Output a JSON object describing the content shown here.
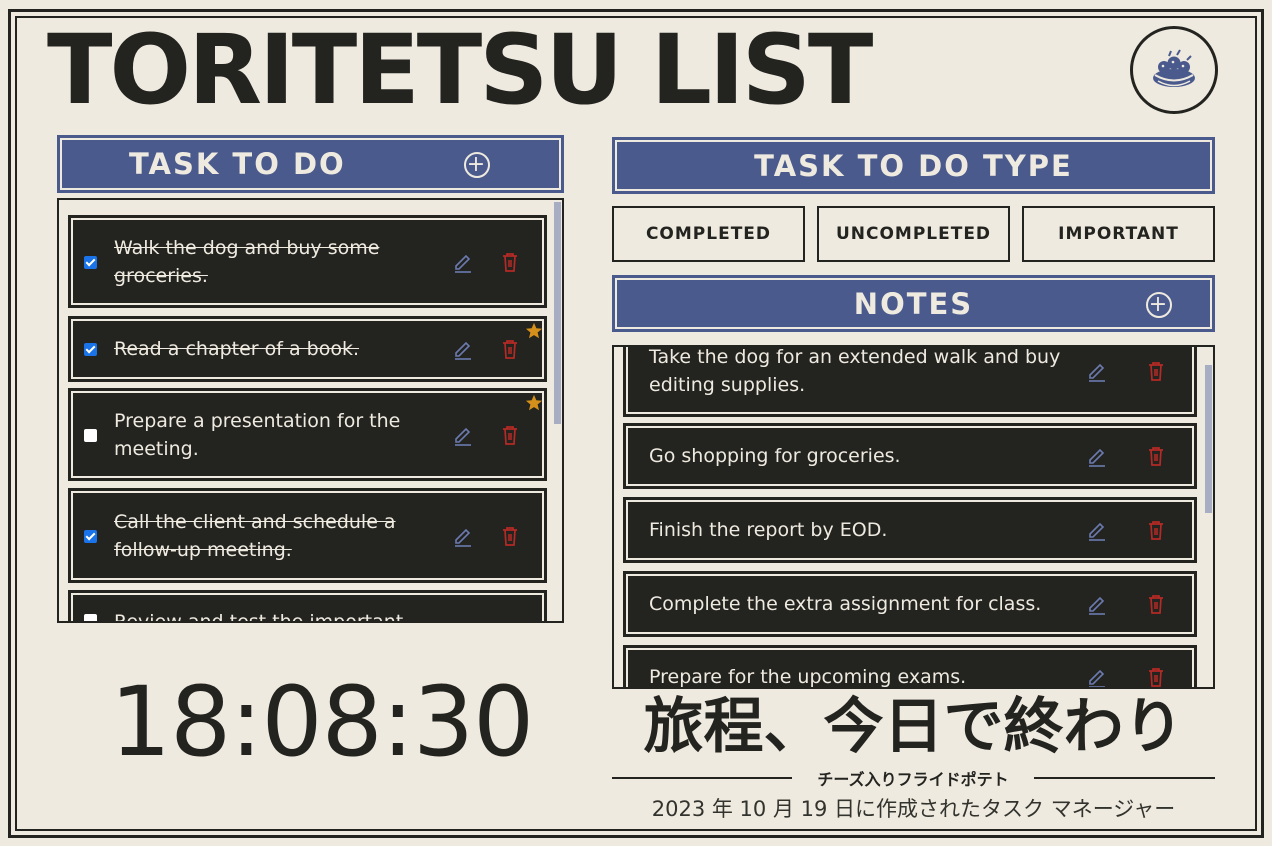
{
  "app_title": "TORITETSU LIST",
  "logo_icon": "bird-nest-icon",
  "colors": {
    "accent": "#4a5a8c",
    "background": "#efeae0",
    "ink": "#23231f",
    "delete": "#b52a26",
    "star": "#d4901a",
    "checkbox": "#1a73e8"
  },
  "task_panel": {
    "title": "TASK TO DO",
    "items": [
      {
        "text": "Walk the dog and buy some groceries.",
        "completed": true,
        "important": false
      },
      {
        "text": "Read a chapter of a book.",
        "completed": true,
        "important": true
      },
      {
        "text": "Prepare a presentation for the meeting.",
        "completed": false,
        "important": true
      },
      {
        "text": "Call the client and schedule a follow-up meeting.",
        "completed": true,
        "important": false
      },
      {
        "text": "Review and test the important",
        "completed": false,
        "important": false
      }
    ]
  },
  "type_panel": {
    "title": "TASK TO DO TYPE",
    "filters": [
      "COMPLETED",
      "UNCOMPLETED",
      "IMPORTANT"
    ]
  },
  "notes_panel": {
    "title": "NOTES",
    "items": [
      {
        "text": "Take the dog for an extended walk and buy editing supplies."
      },
      {
        "text": "Go shopping for groceries."
      },
      {
        "text": "Finish the report by EOD."
      },
      {
        "text": "Complete the extra assignment for class."
      },
      {
        "text": "Prepare for the upcoming exams."
      }
    ]
  },
  "clock": "18:08:30",
  "jp_title": "旅程、今日で終わり",
  "jp_subtitle": "チーズ入りフライドポテト",
  "jp_footer": "2023 年 10 月 19 日に作成されたタスク マネージャー"
}
